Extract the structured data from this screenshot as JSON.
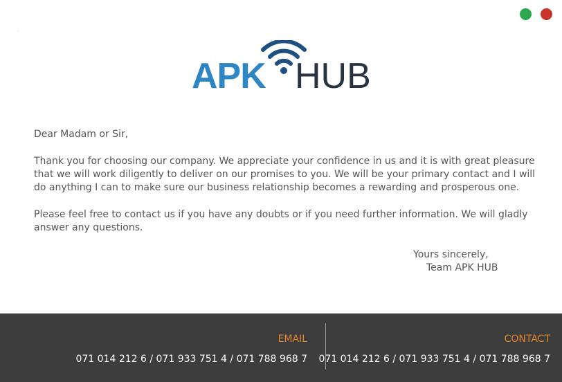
{
  "window": {
    "controls": [
      {
        "name": "green-dot",
        "color": "#2da84f"
      },
      {
        "name": "red-dot",
        "color": "#c9352b"
      }
    ]
  },
  "logo": {
    "part1": "APK",
    "part2": "HUB",
    "icon": "wifi-icon",
    "colors": {
      "apk": "#2f86c4",
      "hub": "#2a3340"
    }
  },
  "letter": {
    "greeting": "Dear Madam or Sir,",
    "paragraph1": "Thank you for choosing our company. We appreciate your confidence in us and it is with great pleasure that we will work diligently to deliver on our promises to you. We will be your primary contact and I will do anything I can to make sure our business relationship becomes a rewarding and prosperous one.",
    "paragraph2": "Please feel free to contact us if you have any doubts or if you need further information. We will gladly answer any questions.",
    "closing": "Yours sincerely,",
    "signature": "Team APK HUB"
  },
  "footer": {
    "email": {
      "title": "EMAIL",
      "value": "071 014 212 6 / 071 933 751 4 / 071 788 968 7"
    },
    "contact": {
      "title": "CONTACT",
      "value": "071 014 212 6 / 071 933 751 4 / 071 788 968 7"
    },
    "colors": {
      "background": "#3d3d3d",
      "accent": "#e0852b"
    }
  }
}
